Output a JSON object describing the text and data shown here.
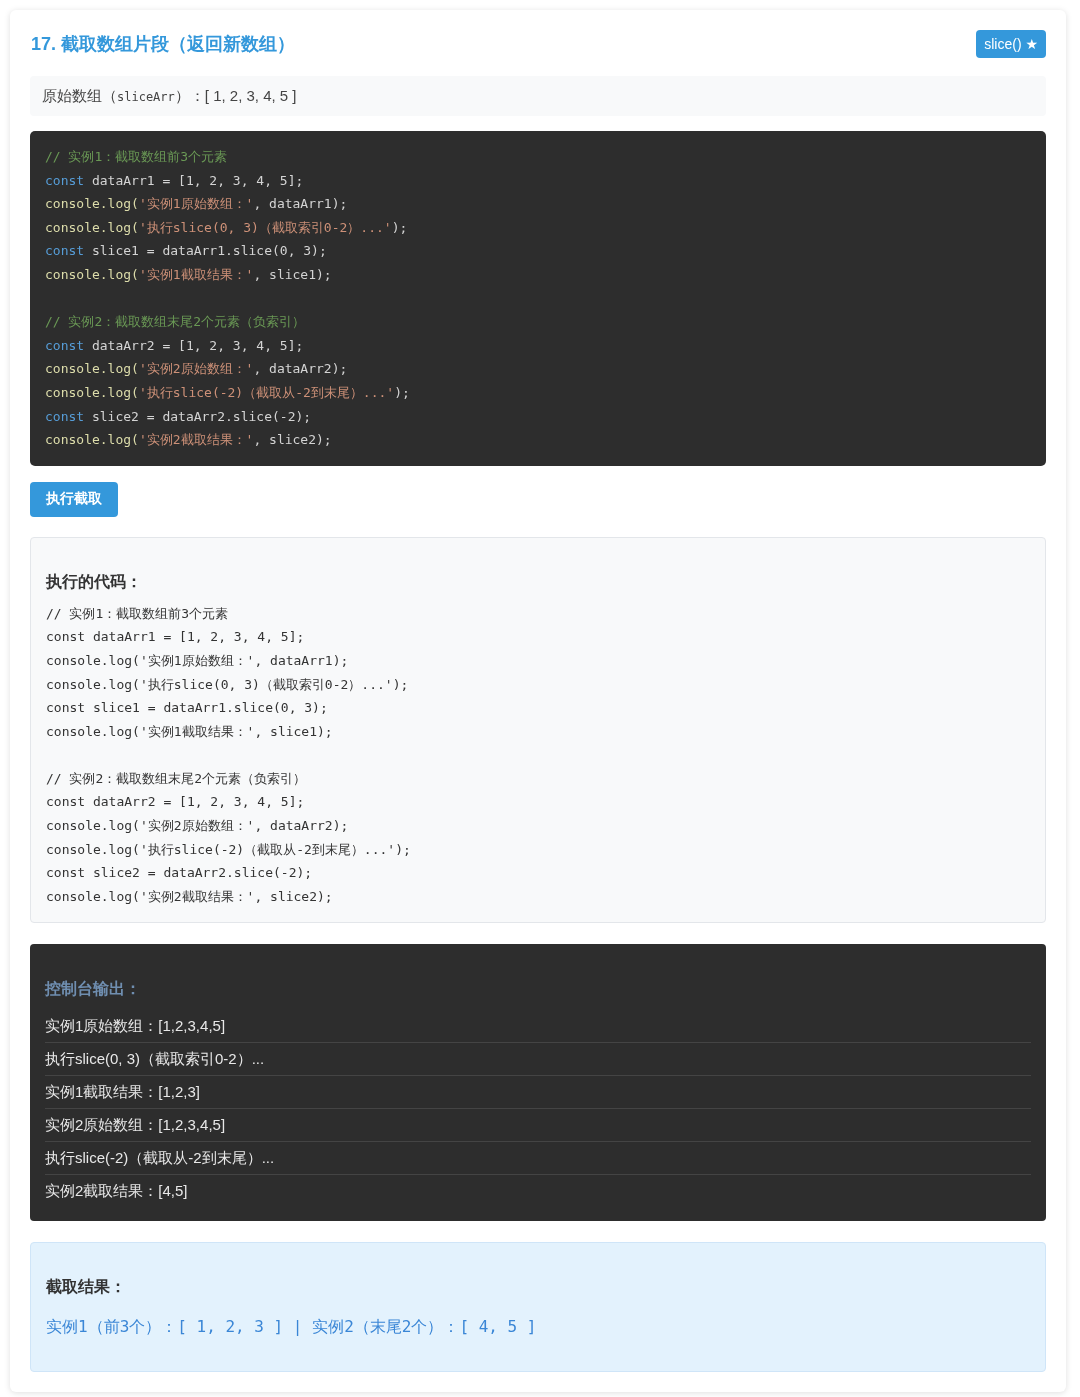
{
  "header": {
    "title": "17. 截取数组片段（返回新数组）",
    "badge": "slice() ★"
  },
  "original_array": {
    "parts": [
      {
        "kind": "text",
        "text": "原始数组（"
      },
      {
        "kind": "code",
        "text": "sliceArr"
      },
      {
        "kind": "text",
        "text": "）：[ 1, 2, 3, 4, 5 ]"
      }
    ]
  },
  "code_editor": {
    "blocks": [
      {
        "lines": [
          {
            "tokens": [
              {
                "kind": "comment",
                "text": "// 实例1：截取数组前3个元素"
              }
            ]
          },
          {
            "tokens": [
              {
                "kind": "keyword",
                "text": "const"
              },
              {
                "kind": "plain",
                "text": " dataArr1 = [1, 2, 3, 4, 5];"
              }
            ]
          },
          {
            "tokens": [
              {
                "kind": "function",
                "text": "console.log("
              },
              {
                "kind": "string",
                "text": "'实例1原始数组：'"
              },
              {
                "kind": "plain",
                "text": ", dataArr1);"
              }
            ]
          },
          {
            "tokens": [
              {
                "kind": "function",
                "text": "console.log("
              },
              {
                "kind": "string",
                "text": "'执行slice(0, 3)（截取索引0-2）...'"
              },
              {
                "kind": "plain",
                "text": ");"
              }
            ]
          },
          {
            "tokens": [
              {
                "kind": "keyword",
                "text": "const"
              },
              {
                "kind": "plain",
                "text": " slice1 = dataArr1.slice(0, 3);"
              }
            ]
          },
          {
            "tokens": [
              {
                "kind": "function",
                "text": "console.log("
              },
              {
                "kind": "string",
                "text": "'实例1截取结果：'"
              },
              {
                "kind": "plain",
                "text": ", slice1);"
              }
            ]
          }
        ]
      },
      {
        "lines": [
          {
            "tokens": [
              {
                "kind": "comment",
                "text": "// 实例2：截取数组末尾2个元素（负索引）"
              }
            ]
          },
          {
            "tokens": [
              {
                "kind": "keyword",
                "text": "const"
              },
              {
                "kind": "plain",
                "text": " dataArr2 = [1, 2, 3, 4, 5];"
              }
            ]
          },
          {
            "tokens": [
              {
                "kind": "function",
                "text": "console.log("
              },
              {
                "kind": "string",
                "text": "'实例2原始数组：'"
              },
              {
                "kind": "plain",
                "text": ", dataArr2);"
              }
            ]
          },
          {
            "tokens": [
              {
                "kind": "function",
                "text": "console.log("
              },
              {
                "kind": "string",
                "text": "'执行slice(-2)（截取从-2到末尾）...'"
              },
              {
                "kind": "plain",
                "text": ");"
              }
            ]
          },
          {
            "tokens": [
              {
                "kind": "keyword",
                "text": "const"
              },
              {
                "kind": "plain",
                "text": " slice2 = dataArr2.slice(-2);"
              }
            ]
          },
          {
            "tokens": [
              {
                "kind": "function",
                "text": "console.log("
              },
              {
                "kind": "string",
                "text": "'实例2截取结果：'"
              },
              {
                "kind": "plain",
                "text": ", slice2);"
              }
            ]
          }
        ]
      }
    ]
  },
  "run_button": {
    "label": "执行截取"
  },
  "executed_code": {
    "title": "执行的代码：",
    "blocks": [
      {
        "lines": [
          "// 实例1：截取数组前3个元素",
          "const dataArr1 = [1, 2, 3, 4, 5];",
          "console.log('实例1原始数组：', dataArr1);",
          "console.log('执行slice(0, 3)（截取索引0-2）...');",
          "const slice1 = dataArr1.slice(0, 3);",
          "console.log('实例1截取结果：', slice1);"
        ]
      },
      {
        "lines": [
          "// 实例2：截取数组末尾2个元素（负索引）",
          "const dataArr2 = [1, 2, 3, 4, 5];",
          "console.log('实例2原始数组：', dataArr2);",
          "console.log('执行slice(-2)（截取从-2到末尾）...');",
          "const slice2 = dataArr2.slice(-2);",
          "console.log('实例2截取结果：', slice2);"
        ]
      }
    ]
  },
  "console_output": {
    "title": "控制台输出：",
    "lines": [
      "实例1原始数组：[1,2,3,4,5]",
      "执行slice(0, 3)（截取索引0-2）...",
      "实例1截取结果：[1,2,3]",
      "实例2原始数组：[1,2,3,4,5]",
      "执行slice(-2)（截取从-2到末尾）...",
      "实例2截取结果：[4,5]"
    ]
  },
  "result": {
    "title": "截取结果：",
    "text": "实例1（前3个）：[ 1, 2, 3 ] | 实例2（末尾2个）：[ 4, 5 ]"
  }
}
